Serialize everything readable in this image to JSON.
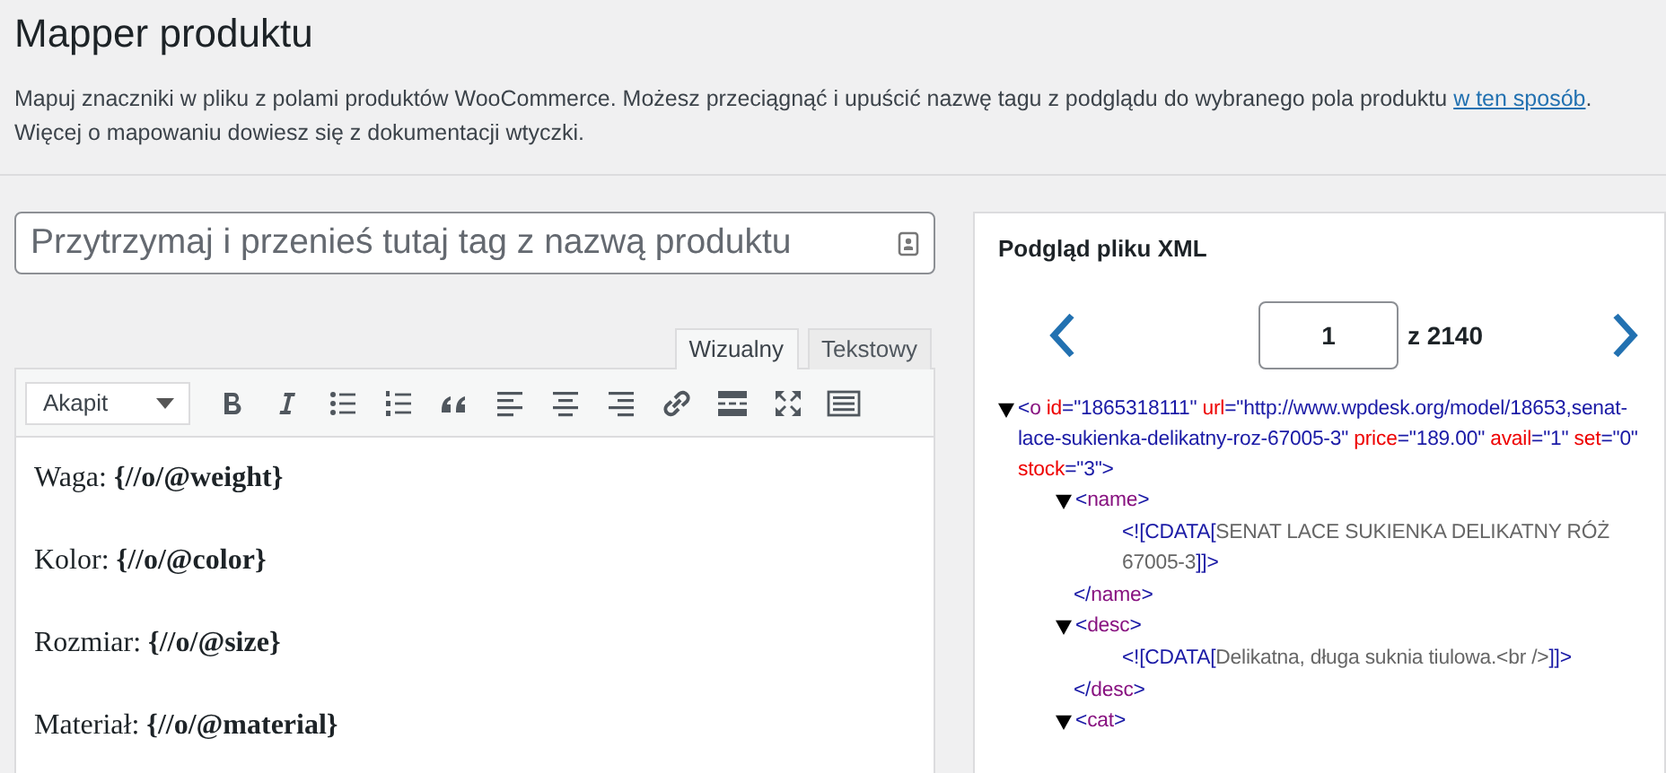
{
  "title": "Mapper produktu",
  "description": {
    "before": "Mapuj znaczniki w pliku z polami produktów WooCommerce. Możesz przeciągnąć i upuścić nazwę tagu z podglądu do wybranego pola produktu ",
    "link": "w ten sposób",
    "after": ".",
    "note": "Więcej o mapowaniu dowiesz się z dokumentacji wtyczki."
  },
  "name_field": {
    "placeholder": "Przytrzymaj i przenieś tutaj tag z nazwą produktu"
  },
  "editor_tabs": [
    {
      "label": "Wizualny",
      "selected": true
    },
    {
      "label": "Tekstowy",
      "selected": false
    }
  ],
  "format_select": {
    "value": "Akapit"
  },
  "editor_lines": [
    "Waga: **{//o/@weight}**",
    "Kolor: **{//o/@color}**",
    "Rozmiar: **{//o/@size}**",
    "Materiał: **{//o/@material}**"
  ],
  "preview": {
    "title": "Podgląd pliku XML",
    "page": "1",
    "of": "z 2140",
    "tree": {
      "expanded": true,
      "open": [
        {
          "kind": "punct",
          "text": "<"
        },
        {
          "kind": "tag",
          "text": "o"
        },
        {
          "kind": "attr",
          "text": " id"
        },
        {
          "kind": "punct",
          "text": "="
        },
        {
          "kind": "value",
          "text": "\"1865318111\""
        },
        {
          "kind": "attr",
          "text": " url"
        },
        {
          "kind": "punct",
          "text": "="
        },
        {
          "kind": "value",
          "text": "\"http://www.wpdesk.org/model/18653,senat-lace-sukienka-delikatny-roz-67005-3\""
        },
        {
          "kind": "attr",
          "text": " price"
        },
        {
          "kind": "punct",
          "text": "="
        },
        {
          "kind": "value",
          "text": "\"189.00\""
        },
        {
          "kind": "attr",
          "text": " avail"
        },
        {
          "kind": "punct",
          "text": "="
        },
        {
          "kind": "value",
          "text": "\"1\""
        },
        {
          "kind": "attr",
          "text": " set"
        },
        {
          "kind": "punct",
          "text": "="
        },
        {
          "kind": "value",
          "text": "\"0\""
        },
        {
          "kind": "attr",
          "text": " stock"
        },
        {
          "kind": "punct",
          "text": "="
        },
        {
          "kind": "value",
          "text": "\"3\""
        },
        {
          "kind": "punct",
          "text": ">"
        }
      ],
      "children": [
        {
          "expanded": true,
          "open": [
            {
              "kind": "punct",
              "text": "<"
            },
            {
              "kind": "tag",
              "text": "name"
            },
            {
              "kind": "punct",
              "text": ">"
            }
          ],
          "content": [
            {
              "kind": "punct",
              "text": "<![CDATA["
            },
            {
              "kind": "text",
              "text": "SENAT LACE SUKIENKA DELIKATNY RÓŻ 67005-3"
            },
            {
              "kind": "punct",
              "text": "]]>"
            }
          ],
          "close": [
            {
              "kind": "punct",
              "text": "</"
            },
            {
              "kind": "tag",
              "text": "name"
            },
            {
              "kind": "punct",
              "text": ">"
            }
          ]
        },
        {
          "expanded": true,
          "open": [
            {
              "kind": "punct",
              "text": "<"
            },
            {
              "kind": "tag",
              "text": "desc"
            },
            {
              "kind": "punct",
              "text": ">"
            }
          ],
          "content": [
            {
              "kind": "punct",
              "text": "<![CDATA["
            },
            {
              "kind": "text",
              "text": "Delikatna, długa suknia tiulowa.<br />"
            },
            {
              "kind": "punct",
              "text": "]]>"
            }
          ],
          "close": [
            {
              "kind": "punct",
              "text": "</"
            },
            {
              "kind": "tag",
              "text": "desc"
            },
            {
              "kind": "punct",
              "text": ">"
            }
          ]
        },
        {
          "expanded": true,
          "open": [
            {
              "kind": "punct",
              "text": "<"
            },
            {
              "kind": "tag",
              "text": "cat"
            },
            {
              "kind": "punct",
              "text": ">"
            }
          ]
        }
      ]
    }
  }
}
